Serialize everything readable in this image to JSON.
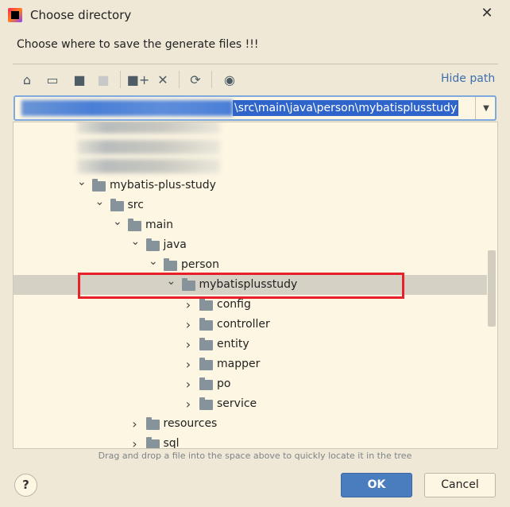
{
  "window": {
    "title": "Choose directory",
    "close_icon": "close-icon"
  },
  "description": "Choose where to save the generate files !!!",
  "toolbar": {
    "icons": [
      "home-icon",
      "desktop-icon",
      "project-folder-icon",
      "module-folder-icon",
      "new-folder-icon",
      "delete-icon",
      "refresh-icon",
      "show-hidden-icon"
    ],
    "hide_path": "Hide path"
  },
  "path": {
    "visible_value": "\\src\\main\\java\\person\\mybatisplusstudy"
  },
  "tree": {
    "rows": [
      {
        "label": "mybatis-plus-study",
        "level": 0,
        "expanded": true
      },
      {
        "label": "src",
        "level": 1,
        "expanded": true
      },
      {
        "label": "main",
        "level": 2,
        "expanded": true
      },
      {
        "label": "java",
        "level": 3,
        "expanded": true
      },
      {
        "label": "person",
        "level": 4,
        "expanded": true
      },
      {
        "label": "mybatisplusstudy",
        "level": 5,
        "expanded": true,
        "selected": true
      },
      {
        "label": "config",
        "level": 6,
        "expanded": false
      },
      {
        "label": "controller",
        "level": 6,
        "expanded": false
      },
      {
        "label": "entity",
        "level": 6,
        "expanded": false
      },
      {
        "label": "mapper",
        "level": 6,
        "expanded": false
      },
      {
        "label": "po",
        "level": 6,
        "expanded": false
      },
      {
        "label": "service",
        "level": 6,
        "expanded": false
      },
      {
        "label": "resources",
        "level": 3,
        "expanded": false
      },
      {
        "label": "sql",
        "level": 3,
        "expanded": false
      }
    ]
  },
  "hint": "Drag and drop a file into the space above to quickly locate it in the tree",
  "buttons": {
    "help": "?",
    "ok": "OK",
    "cancel": "Cancel"
  },
  "colors": {
    "accent": "#4a7dbd",
    "selection": "#2f65ca",
    "highlight_box": "#e8202a"
  }
}
